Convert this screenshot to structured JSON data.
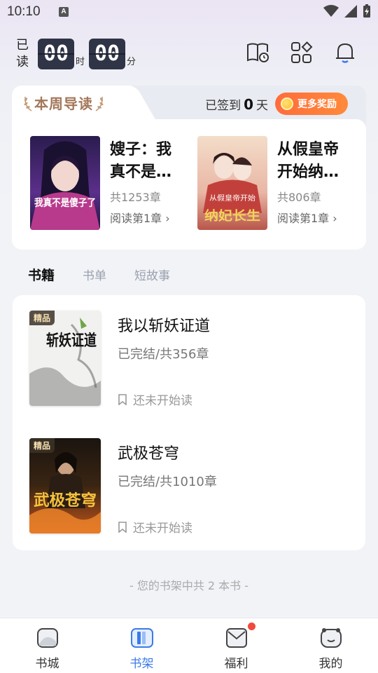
{
  "status_bar": {
    "time": "10:10",
    "indicator": "A"
  },
  "reading_timer": {
    "label_top": "已",
    "label_bottom": "读",
    "hours": "00",
    "hours_unit": "时",
    "minutes": "00",
    "minutes_unit": "分"
  },
  "header_icons": [
    "reading-history-icon",
    "grid-apps-icon",
    "bell-icon"
  ],
  "weekly": {
    "title": "本周导读",
    "checkin_prefix": "已签到",
    "checkin_days": "0",
    "checkin_suffix": "天",
    "more_rewards": "更多奖励",
    "books": [
      {
        "title": "嫂子：我真不是…",
        "chapters": "共1253章",
        "read": "阅读第1章",
        "cover_text": "我真不是傻子了"
      },
      {
        "title": "从假皇帝开始纳…",
        "chapters": "共806章",
        "read": "阅读第1章",
        "cover_text": "纳妃长生",
        "cover_subtitle": "从假皇帝开始"
      }
    ]
  },
  "shelf_tabs": [
    "书籍",
    "书单",
    "短故事"
  ],
  "shelf_books": [
    {
      "badge": "精品",
      "title": "我以斩妖证道",
      "status": "已完结/共356章",
      "progress": "还未开始读",
      "cover_text": "斩妖证道"
    },
    {
      "badge": "精品",
      "title": "武极苍穹",
      "status": "已完结/共1010章",
      "progress": "还未开始读",
      "cover_text": "武极苍穹"
    }
  ],
  "shelf_count": "- 您的书架中共 2 本书 -",
  "bottom_nav": [
    {
      "label": "书城",
      "icon": "bookstore-icon",
      "active": false
    },
    {
      "label": "书架",
      "icon": "bookshelf-icon",
      "active": true
    },
    {
      "label": "福利",
      "icon": "welfare-icon",
      "active": false,
      "badge_dot": true
    },
    {
      "label": "我的",
      "icon": "profile-icon",
      "active": false
    }
  ],
  "colors": {
    "accent": "#3b7be8",
    "orange": "#ff6c3c",
    "timer_box": "#2f3446",
    "weekly_title": "#a3775a"
  }
}
